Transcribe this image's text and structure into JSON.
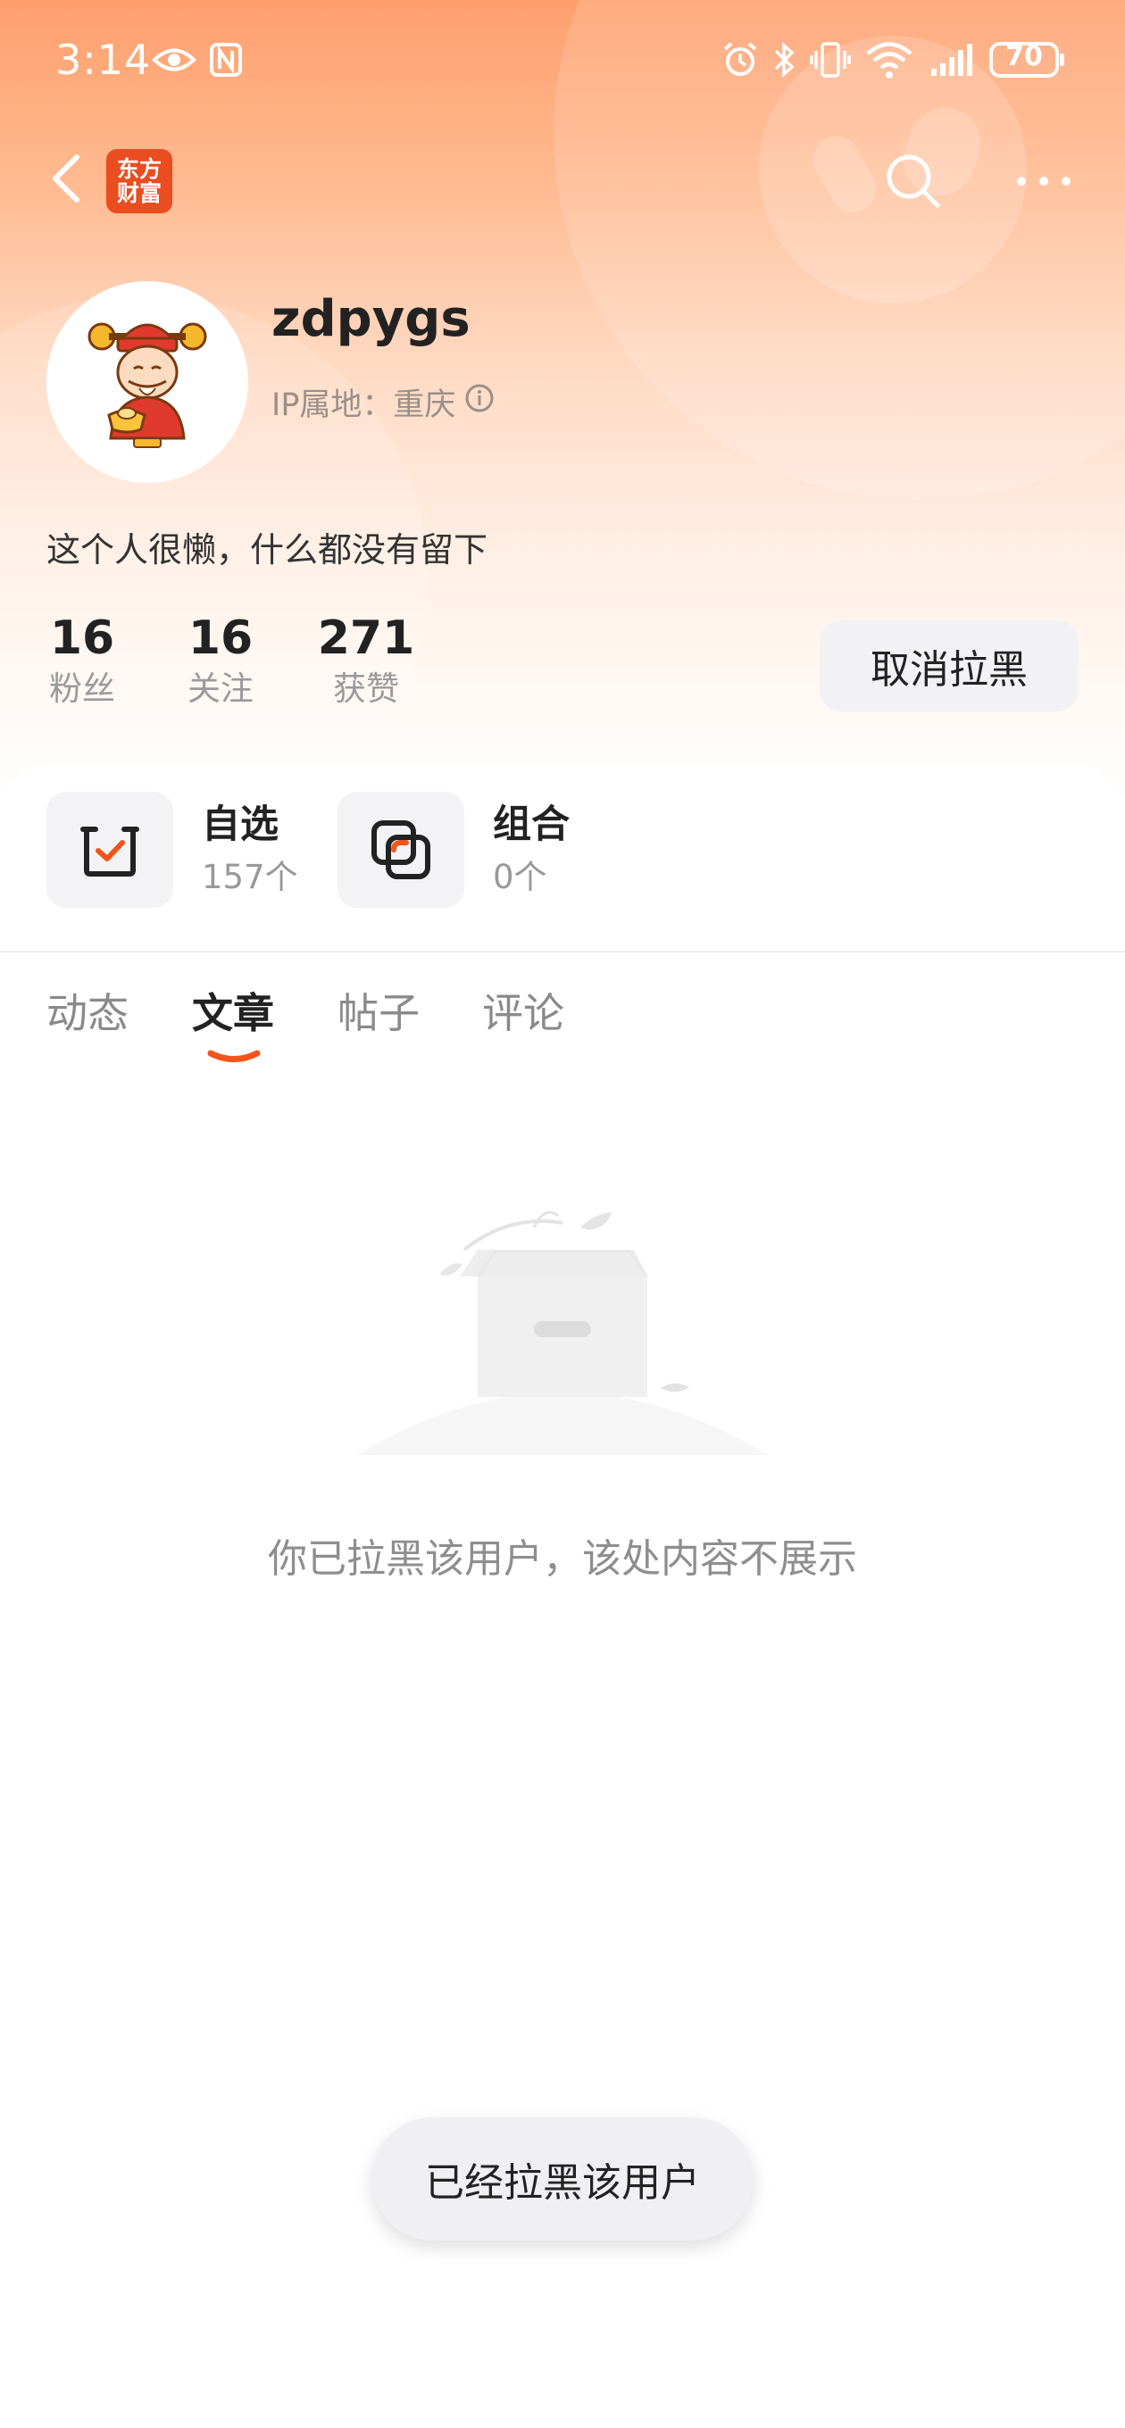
{
  "status_bar": {
    "time": "3:14",
    "battery": "70"
  },
  "nav": {
    "logo_line1": "东方",
    "logo_line2": "财富",
    "back_icon": "chevron-left-icon",
    "search_icon": "search-icon",
    "more_icon": "more-dots-icon"
  },
  "profile": {
    "username": "zdpygs",
    "ip_location": "IP属地：重庆",
    "bio": "这个人很懒，什么都没有留下",
    "stats": [
      {
        "value": "16",
        "label": "粉丝"
      },
      {
        "value": "16",
        "label": "关注"
      },
      {
        "value": "271",
        "label": "获赞"
      }
    ],
    "unblock_label": "取消拉黑"
  },
  "portfolio": [
    {
      "title": "自选",
      "count": "157个",
      "icon": "watchlist-check-icon"
    },
    {
      "title": "组合",
      "count": "0个",
      "icon": "portfolio-combo-icon"
    }
  ],
  "tabs": [
    {
      "label": "动态",
      "active": false
    },
    {
      "label": "文章",
      "active": true
    },
    {
      "label": "帖子",
      "active": false
    },
    {
      "label": "评论",
      "active": false
    }
  ],
  "empty_state": {
    "message": "你已拉黑该用户，该处内容不展示",
    "icon": "empty-box-icon"
  },
  "toast": {
    "message": "已经拉黑该用户"
  },
  "colors": {
    "brand": "#ea4d1f",
    "accent_underline": "#f2541b",
    "header_gradient_top": "#ff9f6e"
  }
}
